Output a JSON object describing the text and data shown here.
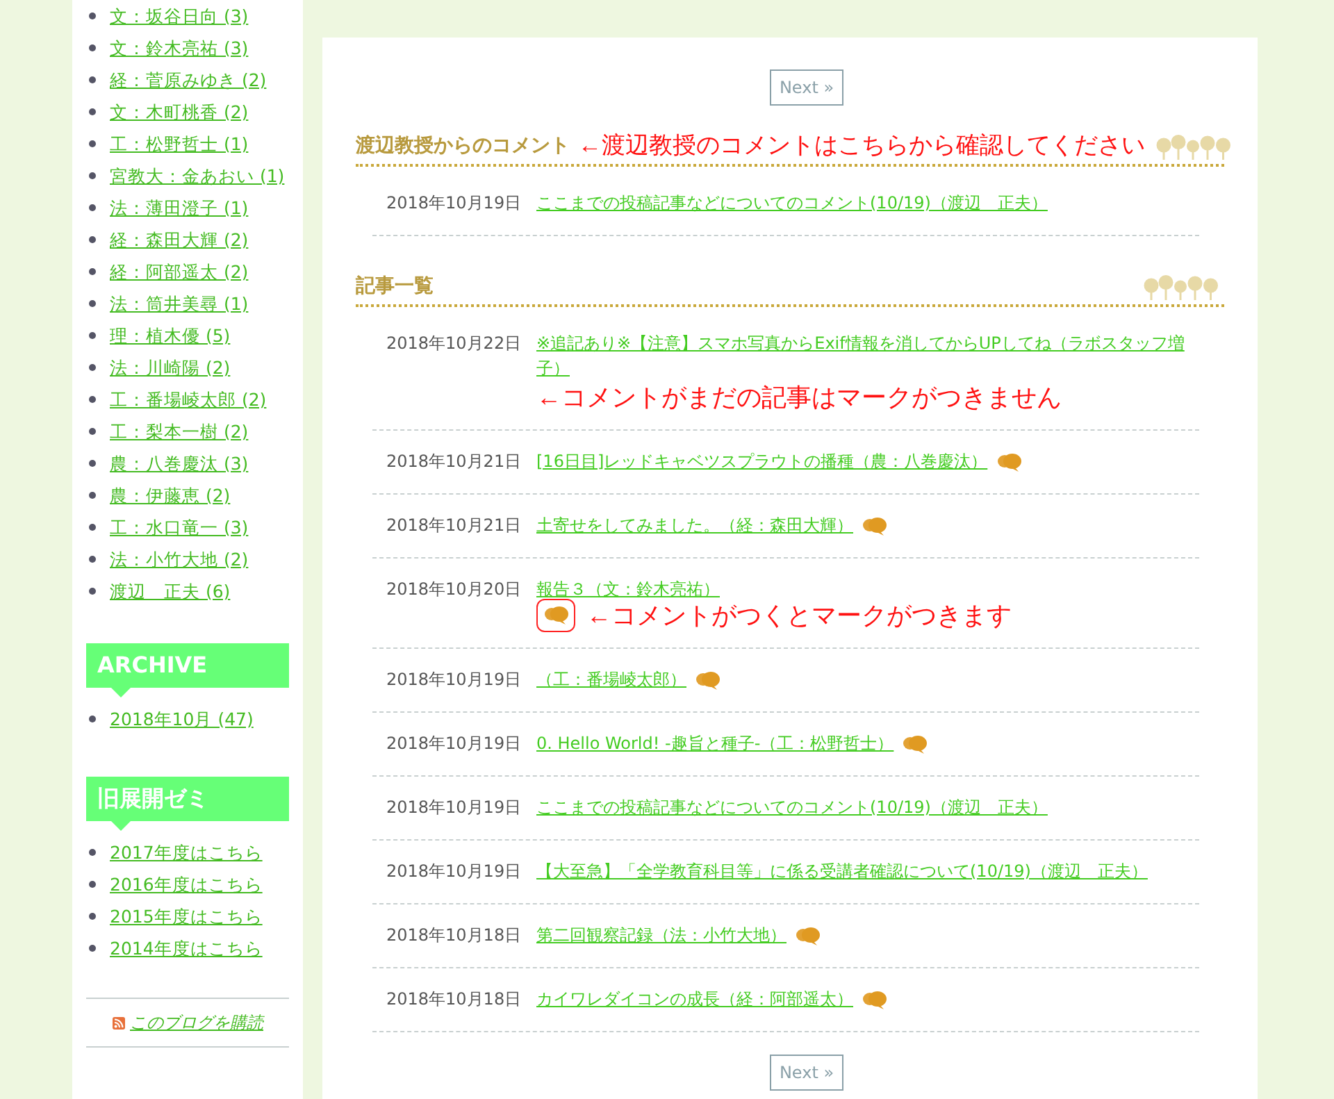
{
  "sidebar": {
    "authors": [
      {
        "label": "文：坂谷日向 (3)"
      },
      {
        "label": "文：鈴木亮祐 (3)"
      },
      {
        "label": "経：菅原みゆき (2)"
      },
      {
        "label": "文：木町桃香 (2)"
      },
      {
        "label": "工：松野哲士 (1)"
      },
      {
        "label": "宮教大：金あおい (1)"
      },
      {
        "label": "法：薄田澄子 (1)"
      },
      {
        "label": "経：森田大輝 (2)"
      },
      {
        "label": "経：阿部遥太 (2)"
      },
      {
        "label": "法：筒井美尋 (1)"
      },
      {
        "label": "理：植木優 (5)"
      },
      {
        "label": "法：川崎陽 (2)"
      },
      {
        "label": "工：番場崚太郎 (2)"
      },
      {
        "label": "工：梨本一樹 (2)"
      },
      {
        "label": "農：八巻慶汰 (3)"
      },
      {
        "label": "農：伊藤恵 (2)"
      },
      {
        "label": "工：水口竜一 (3)"
      },
      {
        "label": "法：小竹大地 (2)"
      },
      {
        "label": "渡辺　正夫 (6)"
      }
    ],
    "archive": {
      "title": "ARCHIVE",
      "items": [
        "2018年10月 (47)"
      ]
    },
    "past": {
      "title": "旧展開ゼミ",
      "items": [
        "2017年度はこちら",
        "2016年度はこちら",
        "2015年度はこちら",
        "2014年度はこちら"
      ]
    },
    "subscribe": "このブログを購読"
  },
  "main": {
    "next_top": "Next »",
    "comment_section": {
      "title": "渡辺教授からのコメント",
      "annotation": "←渡辺教授のコメントはこちらから確認してください",
      "posts": [
        {
          "date": "2018年10月19日",
          "title": "ここまでの投稿記事などについてのコメント(10/19)（渡辺　正夫）",
          "commented": false,
          "highlighted": false
        }
      ]
    },
    "list_section": {
      "title": "記事一覧",
      "posts": [
        {
          "date": "2018年10月22日",
          "title": "※追記あり※【注意】スマホ写真からExif情報を消してからUPしてね（ラボスタッフ増子）",
          "commented": false,
          "highlighted": false,
          "annotation": "←コメントがまだの記事はマークがつきません"
        },
        {
          "date": "2018年10月21日",
          "title": "[16日目]レッドキャベツスプラウトの播種（農：八巻慶汰）",
          "commented": true,
          "highlighted": false
        },
        {
          "date": "2018年10月21日",
          "title": "土寄せをしてみました。（経：森田大輝）",
          "commented": true,
          "highlighted": false
        },
        {
          "date": "2018年10月20日",
          "title": "報告３（文：鈴木亮祐）",
          "commented": true,
          "highlighted": true,
          "annotation": "←コメントがつくとマークがつきます"
        },
        {
          "date": "2018年10月19日",
          "title": "（工：番場崚太郎）",
          "commented": true,
          "highlighted": false
        },
        {
          "date": "2018年10月19日",
          "title": "0. Hello World! -趣旨と種子-（工：松野哲士）",
          "commented": true,
          "highlighted": false
        },
        {
          "date": "2018年10月19日",
          "title": "ここまでの投稿記事などについてのコメント(10/19)（渡辺　正夫）",
          "commented": false,
          "highlighted": false
        },
        {
          "date": "2018年10月19日",
          "title": "【大至急】「全学教育科目等」に係る受講者確認について(10/19)（渡辺　正夫）",
          "commented": false,
          "highlighted": false
        },
        {
          "date": "2018年10月18日",
          "title": "第二回観察記録（法：小竹大地）",
          "commented": true,
          "highlighted": false
        },
        {
          "date": "2018年10月18日",
          "title": "カイワレダイコンの成長（経：阿部遥太）",
          "commented": true,
          "highlighted": false
        }
      ]
    },
    "next_bottom": "Next »"
  }
}
